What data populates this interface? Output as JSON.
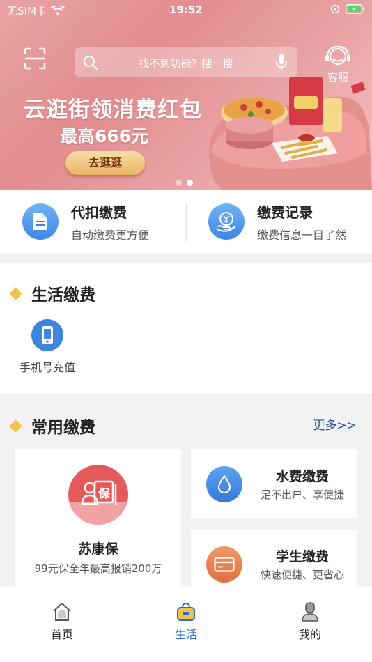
{
  "status_bar": {
    "carrier": "无SIM卡",
    "time": "19:52"
  },
  "header": {
    "search_placeholder": "找不到功能？搜一搜",
    "service_label": "客服"
  },
  "banner": {
    "title": "云逛街领消费红包",
    "subtitle": "最高666元",
    "button_label": "去逛逛",
    "slide_count": 2,
    "active_slide": 2
  },
  "quick": [
    {
      "title": "代扣缴费",
      "desc": "自动缴费更方便",
      "icon": "document-icon"
    },
    {
      "title": "缴费记录",
      "desc": "缴费信息一目了然",
      "icon": "yen-hand-icon"
    }
  ],
  "life": {
    "title": "生活缴费",
    "items": [
      {
        "label": "手机号充值",
        "icon": "phone-icon"
      }
    ]
  },
  "common": {
    "title": "常用缴费",
    "more_label": "更多>>",
    "featured": {
      "name": "苏康保",
      "desc": "99元保全年最高报销200万",
      "icon": "insurance-icon",
      "icon_text": "保"
    },
    "items": [
      {
        "title": "水费缴费",
        "desc": "足不出户、享便捷",
        "icon": "water-drop-icon",
        "color": "#3f86e4"
      },
      {
        "title": "学生缴费",
        "desc": "快速便捷、更省心",
        "icon": "card-icon",
        "color": "#e8794a"
      }
    ]
  },
  "tabbar": {
    "items": [
      {
        "label": "首页",
        "icon": "home-icon",
        "active": false
      },
      {
        "label": "生活",
        "icon": "shopping-bag-icon",
        "active": true
      },
      {
        "label": "我的",
        "icon": "user-icon",
        "active": false
      }
    ]
  },
  "colors": {
    "accent": "#2a6bd6",
    "link": "#2a4f9c",
    "diamond": "#f2c24b",
    "banner": "#e28d8f"
  }
}
